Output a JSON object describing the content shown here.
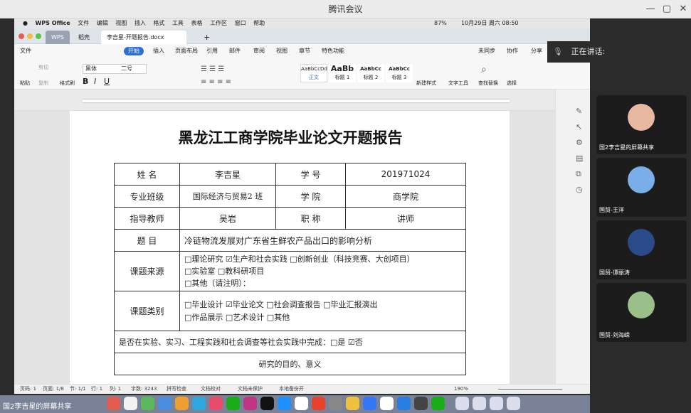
{
  "meeting": {
    "title": "腾讯会议",
    "speaking_label": "正在讲话:"
  },
  "mac_menu": {
    "app": "WPS Office",
    "items": [
      "文件",
      "编辑",
      "视图",
      "插入",
      "格式",
      "工具",
      "表格",
      "工作区",
      "窗口",
      "帮助"
    ],
    "battery": "87%",
    "datetime": "10月29日 周六 08:50"
  },
  "wps_tabs": {
    "wps": "WPS",
    "daoke": "稻壳",
    "document": "李吉星-开题报告.docx",
    "add": "+"
  },
  "wps_menu": {
    "file": "文件",
    "start": "开始",
    "items": [
      "插入",
      "页面布局",
      "引用",
      "邮件",
      "审阅",
      "视图",
      "章节",
      "特色功能"
    ],
    "right": [
      "未同步",
      "协作",
      "分享"
    ]
  },
  "ribbon": {
    "paste": "粘贴",
    "cut": "剪切",
    "copy": "复制",
    "format_painter": "格式刷",
    "font": "黑体",
    "size": "二号",
    "styles": [
      {
        "preview": "AaBbCcDd",
        "name": "正文"
      },
      {
        "preview": "AaBb",
        "name": "标题 1"
      },
      {
        "preview": "AaBbCc",
        "name": "标题 2"
      },
      {
        "preview": "AaBbCc",
        "name": "标题 3"
      }
    ],
    "new_style": "新建样式",
    "text_tools": "文字工具",
    "find_replace": "查找替换",
    "select": "选择"
  },
  "document": {
    "title": "黑龙江工商学院毕业论文开题报告",
    "rows": {
      "name_label": "姓 名",
      "name_value": "李吉星",
      "id_label": "学 号",
      "id_value": "201971024",
      "major_label": "专业班级",
      "major_value": "国际经济与贸易2 班",
      "college_label": "学 院",
      "college_value": "商学院",
      "advisor_label": "指导教师",
      "advisor_value": "吴岩",
      "rank_label": "职 称",
      "rank_value": "讲师",
      "topic_label": "题 目",
      "topic_value": "冷链物流发展对广东省生鲜农产品出口的影响分析",
      "source_label": "课题来源",
      "source_line1": "□理论研究 ☑生产和社会实践 □创新创业（科技竞赛、大创项目）",
      "source_line2": "□实验室 □教科研项目",
      "source_line3": "□其他（请注明）：",
      "category_label": "课题类别",
      "category_line1": "□毕业设计 ☑毕业论文 □社会调查报告 □毕业汇报演出",
      "category_line2": "□作品展示 □艺术设计 □其他",
      "practice": "是否在实验、实习、工程实践和社会调查等社会实践中完成：□是 ☑否",
      "purpose": "研究的目的、意义"
    }
  },
  "statusbar": {
    "page": "页码: 1",
    "pages": "页面: 1/8",
    "section": "节: 1/1",
    "row": "行: 1",
    "col": "列: 1",
    "words": "字数: 3243",
    "spell": "拼写检查",
    "proof": "文档校对",
    "unprotected": "文档未保护",
    "backup": "本地备份开",
    "zoom": "190%"
  },
  "participants": [
    {
      "name": "国2李吉星的屏幕共享",
      "color": "#e9b8a0"
    },
    {
      "name": "国贸-王洋",
      "color": "#7aaee8"
    },
    {
      "name": "国贸-谭丽涛",
      "color": "#2a4a8a"
    },
    {
      "name": "国贸-刘海嵘",
      "color": "#9bbf8a"
    }
  ],
  "share_label": "国2李吉星的屏幕共享",
  "colors": {
    "accent": "#2b6fd6",
    "meeting_bg": "#2b2b2b"
  }
}
